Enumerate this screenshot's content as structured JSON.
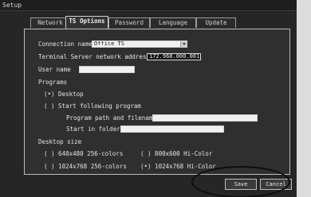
{
  "window": {
    "title": "Setup"
  },
  "tabs": [
    {
      "label": "Network"
    },
    {
      "label": "TS Options"
    },
    {
      "label": "Password"
    },
    {
      "label": "Language"
    },
    {
      "label": "Update"
    }
  ],
  "ts_options": {
    "connection_name_label": "Connection name",
    "connection_name_value": "Office TS",
    "server_address_label": "Terminal Server network address",
    "server_address_value": "172.968.000.001",
    "user_name_label": "User name",
    "user_name_value": "",
    "programs_heading": "Programs",
    "desktop_option": "(•) Desktop",
    "start_program_option": "( ) Start following program",
    "program_path_label": "Program path and filename",
    "program_path_value": "",
    "start_folder_label": "Start in folder",
    "start_folder_value": "",
    "desktop_size_heading": "Desktop size",
    "size_640": "( ) 640x480 256-colors",
    "size_800": "( ) 800x600 Hi-Color",
    "size_1024": "( ) 1024x768 256-colors",
    "size_1024_hi": "(•) 1024x768 Hi-Color"
  },
  "buttons": {
    "save": "Save",
    "cancel": "Cancel"
  }
}
